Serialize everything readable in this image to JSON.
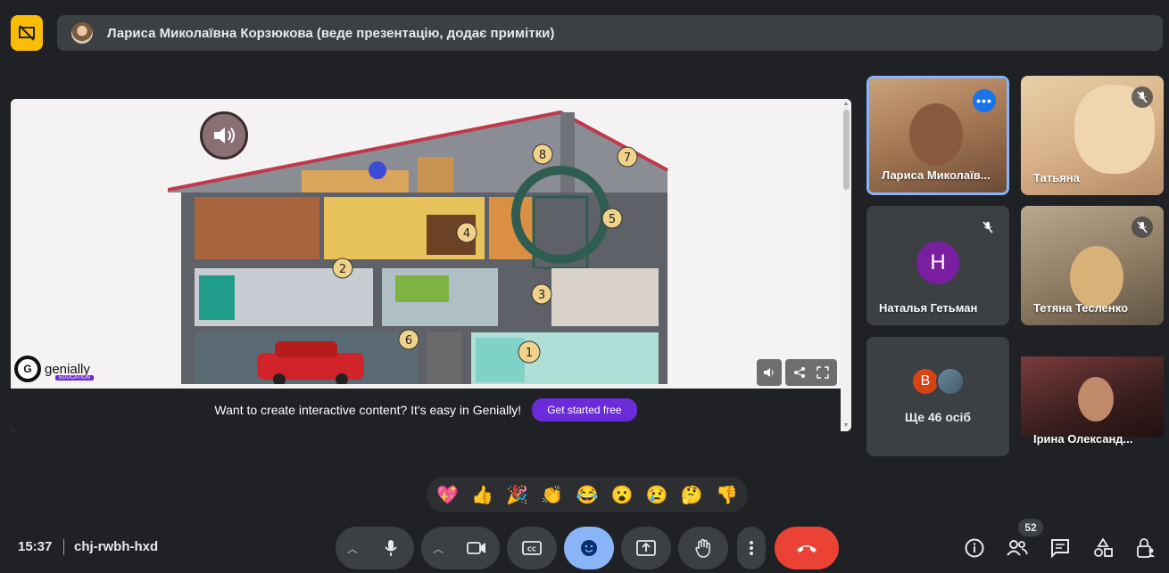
{
  "banner": {
    "presenter_text": "Лариса Миколаївна Корзюкова (веде презентацію, додає примітки)"
  },
  "presentation": {
    "brand": "genially",
    "brand_sub": "EDUCATION",
    "cta_text": "Want to create interactive content? It's easy in Genially!",
    "cta_button": "Get started free",
    "hotspots": [
      "1",
      "2",
      "3",
      "4",
      "5",
      "6",
      "7",
      "8"
    ]
  },
  "participants": [
    {
      "name": "Лариса Миколаїв...",
      "state": "speaking"
    },
    {
      "name": "Татьяна",
      "state": "muted"
    },
    {
      "name": "Наталья Гетьман",
      "initial": "Н",
      "state": "muted"
    },
    {
      "name": "Тетяна Тесленко",
      "state": "muted"
    },
    {
      "more_label": "Ще 46 осіб",
      "initial": "В"
    },
    {
      "name": "Ірина Олександ..."
    }
  ],
  "reactions": [
    "💖",
    "👍",
    "🎉",
    "👏",
    "😂",
    "😮",
    "😢",
    "🤔",
    "👎"
  ],
  "bottom": {
    "time": "15:37",
    "meeting_code": "chj-rwbh-hxd",
    "people_count": "52"
  },
  "colors": {
    "accent": "#8ab4f8",
    "end_call": "#ea4335",
    "present_banner": "#fbbc04",
    "genially_purple": "#6c2bd9"
  }
}
